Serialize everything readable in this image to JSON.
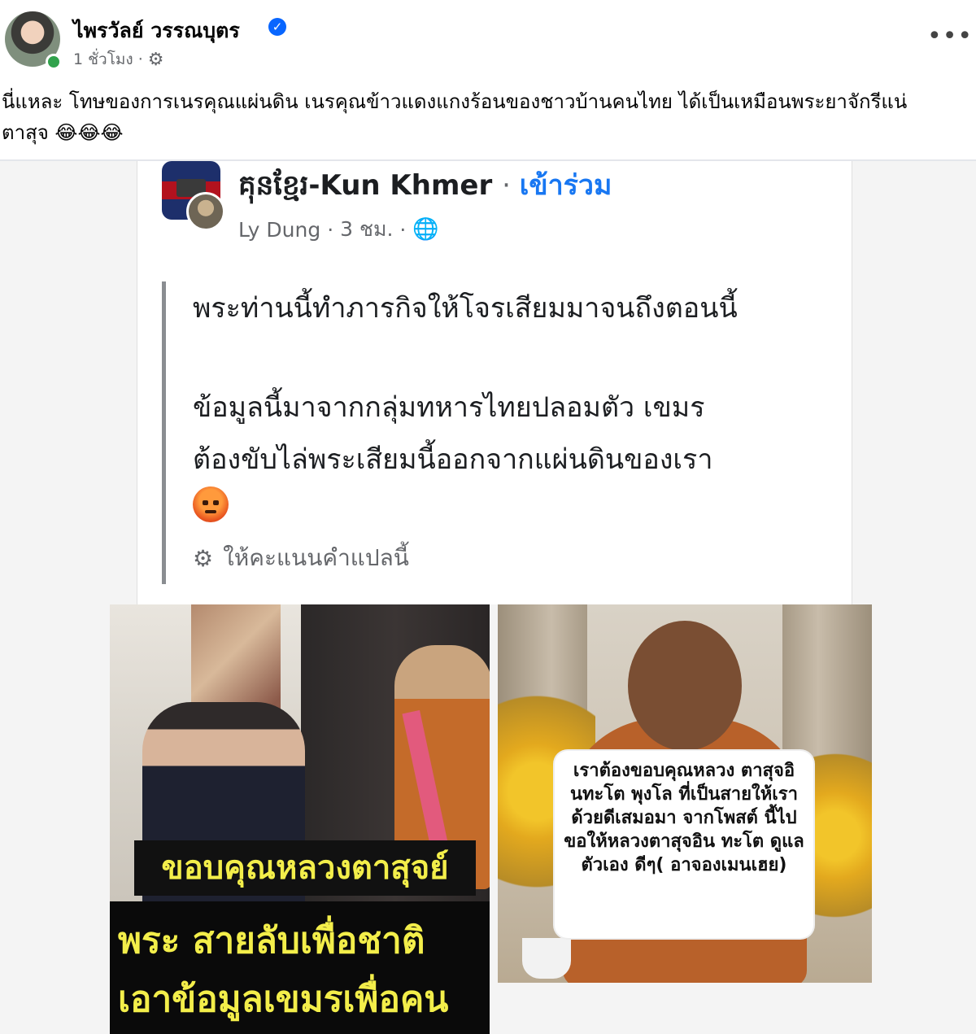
{
  "post": {
    "author": "ไพรวัลย์ วรรณบุตร",
    "time": "1 ชั่วโมง ·",
    "caption": "นี่แหละ โทษของการเนรคุณแผ่นดิน เนรคุณข้าวแดงแกงร้อนของชาวบ้านคนไทย ได้เป็นเหมือนพระยาจักรีแน่",
    "caption_line2": "ตาสุจ",
    "emojis": "😂😂😂"
  },
  "shared": {
    "group_name": "គុនខ្មែរ-Kun Khmer",
    "join": "เข้าร่วม",
    "poster": "Ly Dung",
    "time": "3 ชม.",
    "line1": "พระท่านนี้ทำภารกิจให้โจรเสียมมาจนถึงตอนนี้",
    "line2": "ข้อมูลนี้มาจากกลุ่มทหารไทยปลอมตัว เขมร",
    "line3": "ต้องขับไล่พระเสียมนี้ออกจากแผ่นดินของเรา",
    "rate": "ให้คะแนนคำแปลนี้",
    "left_caption_1": "ขอบคุณหลวงตาสุจย์",
    "left_caption_2a": "พระ สายลับเพื่อชาติ",
    "left_caption_2b": "เอาข้อมูลเขมรเพื่อคน",
    "right_caption": "เราต้องขอบคุณหลวง ตาสุจอินทะโต พุงโล ที่เป็นสายให้เรา ด้วยดีเสมอมา จากโพสต์ นี้ไปขอให้หลวงตาสุจอิน ทะโต ดูแลตัวเอง ดีๆ( อาจองเมนเฮย)"
  },
  "icons": {
    "gear": "gear-icon",
    "globe": "globe-icon",
    "more": "more-icon",
    "verified": "verified-badge-icon"
  },
  "colors": {
    "link_blue": "#1877f2",
    "caption_yellow": "#f3ee4a",
    "online_green": "#31a24c"
  }
}
